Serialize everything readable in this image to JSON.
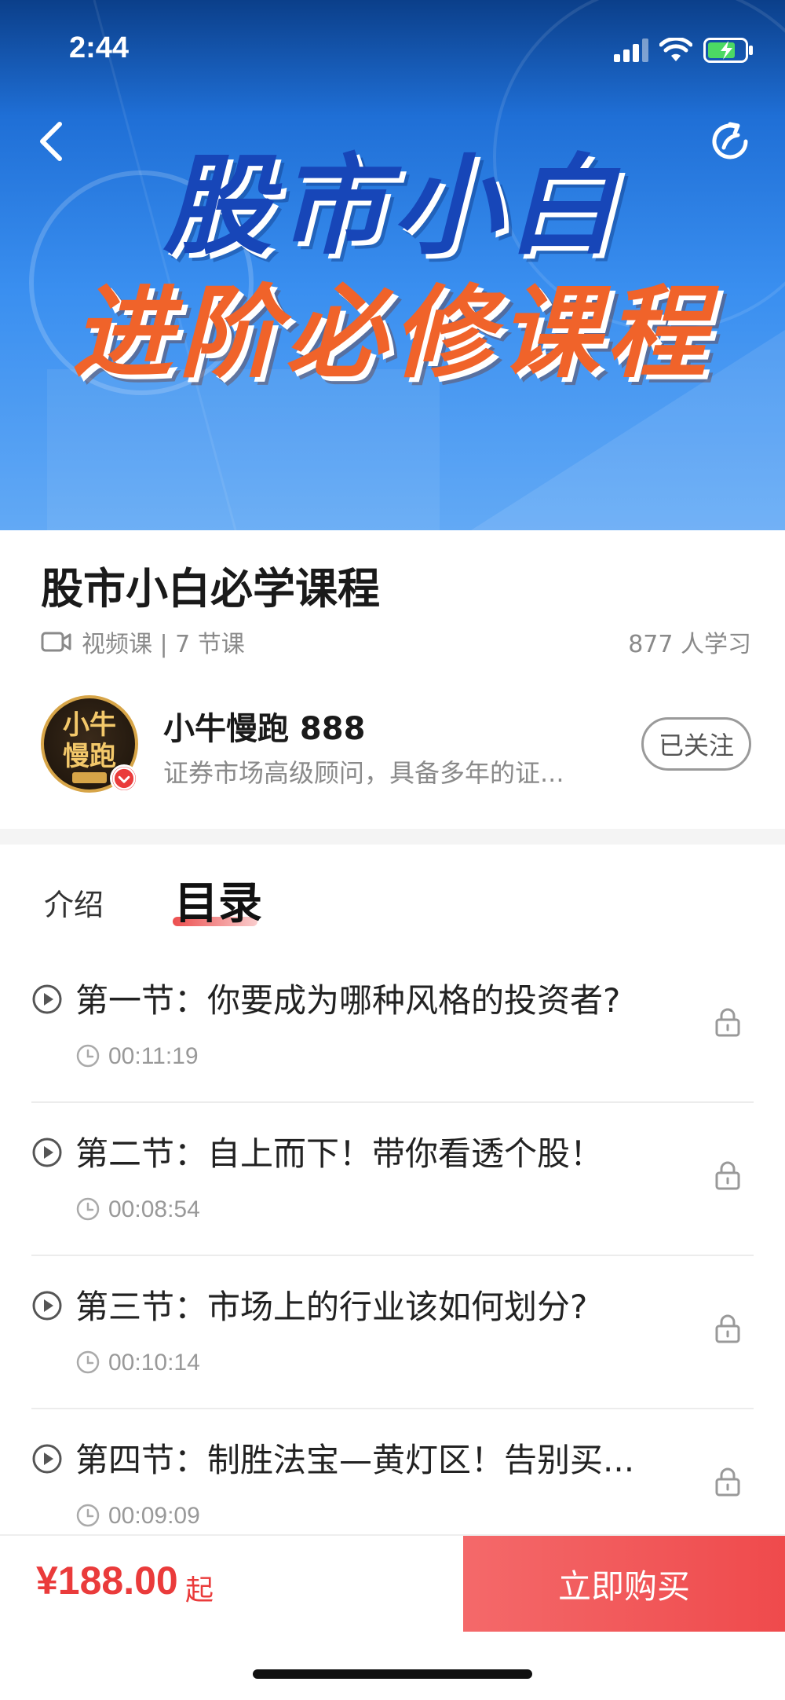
{
  "status_bar": {
    "time": "2:44"
  },
  "hero": {
    "title_line1": "股市小白",
    "title_line2": "进阶必修课程"
  },
  "course": {
    "title": "股市小白必学课程",
    "type": "视频课 | 7 节课",
    "learners": "877 人学习"
  },
  "author": {
    "avatar_text_line1": "小牛",
    "avatar_text_line2": "慢跑",
    "name": "小牛慢跑 888",
    "description": "证券市场高级顾问，具备多年的证...",
    "follow_label": "已关注"
  },
  "tabs": {
    "intro": "介绍",
    "catalog": "目录"
  },
  "lessons": [
    {
      "title": "第一节：你要成为哪种风格的投资者?",
      "duration": "00:11:19"
    },
    {
      "title": "第二节：自上而下！带你看透个股！",
      "duration": "00:08:54"
    },
    {
      "title": "第三节：市场上的行业该如何划分?",
      "duration": "00:10:14"
    },
    {
      "title": "第四节：制胜法宝—黄灯区！告别买...",
      "duration": "00:09:09"
    }
  ],
  "bottom_bar": {
    "price": "¥188.00",
    "price_suffix": "起",
    "buy_label": "立即购买"
  },
  "colors": {
    "accent": "#ea3b3b",
    "hero_blue": "#1f6fd6",
    "hero_orange": "#f0632a"
  }
}
